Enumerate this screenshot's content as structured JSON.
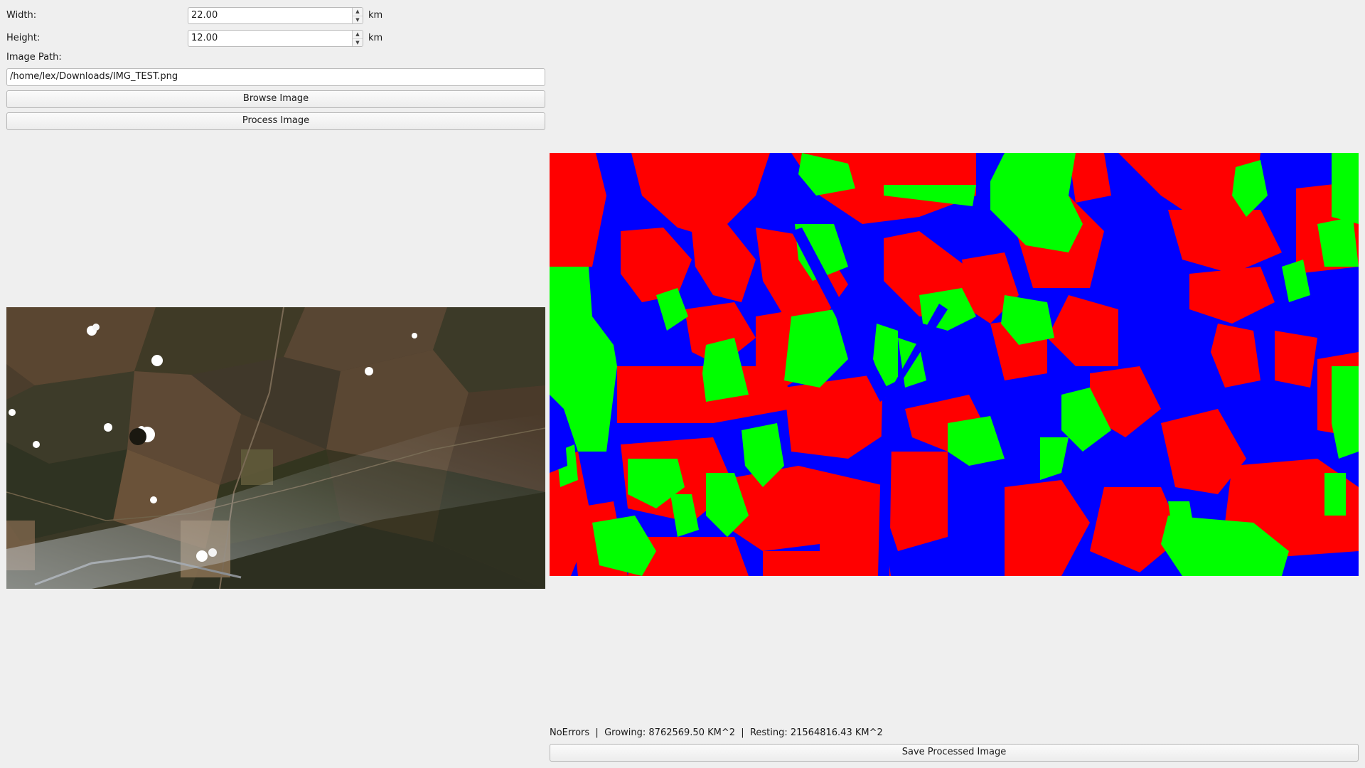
{
  "form": {
    "width_label": "Width:",
    "width_value": "22.00",
    "width_unit": "km",
    "height_label": "Height:",
    "height_value": "12.00",
    "height_unit": "km",
    "path_label": "Image Path:",
    "path_value": "/home/lex/Downloads/IMG_TEST.png"
  },
  "buttons": {
    "browse": "Browse Image",
    "process": "Process Image",
    "save": "Save Processed Image"
  },
  "status": {
    "error": "NoErrors",
    "separator": "|",
    "growing": "Growing: 8762569.50 KM^2",
    "resting": "Resting: 21564816.43 KM^2"
  },
  "icons": {
    "spin_up": "spin-up-icon",
    "spin_down": "spin-down-icon"
  },
  "colors": {
    "growing": "#00ff00",
    "resting": "#ff0000",
    "other": "#0000ff"
  }
}
